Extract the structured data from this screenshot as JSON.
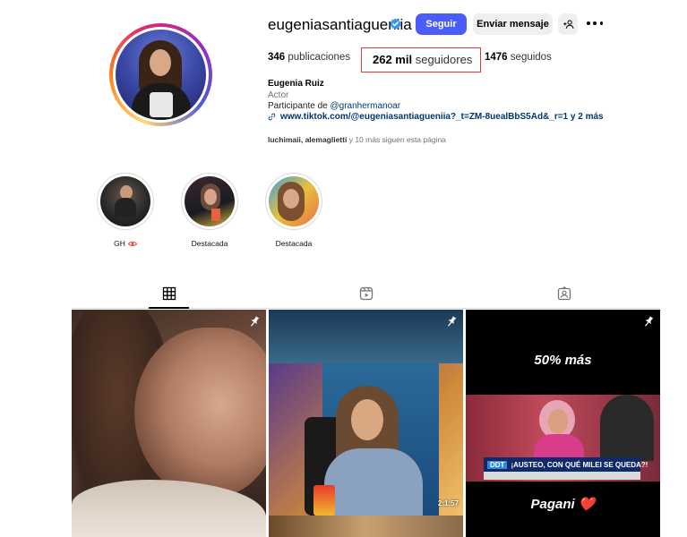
{
  "profile": {
    "username": "eugeniasantiagueniia",
    "follow_label": "Seguir",
    "message_label": "Enviar mensaje",
    "stats": {
      "posts_count": "346",
      "posts_label": "publicaciones",
      "followers_count": "262 mil",
      "followers_label": "seguidores",
      "following_count": "1476",
      "following_label": "seguidos"
    },
    "bio": {
      "name": "Eugenia Ruiz",
      "category": "Actor",
      "line_prefix": "Participante de ",
      "mention": "@granhermanoar",
      "link": "www.tiktok.com/@eugeniasantiagueniia?_t=ZM-8uealBbS5Ad&_r=1 y 2 más"
    },
    "followed_by": {
      "names": "luchimaii, alemaglietti",
      "suffix": " y 10 más siguen esta página"
    }
  },
  "highlights": [
    {
      "label": "GH"
    },
    {
      "label": "Destacada"
    },
    {
      "label": "Destacada"
    }
  ],
  "tabs": [
    {
      "icon": "grid-icon",
      "active": true
    },
    {
      "icon": "reels-icon",
      "active": false
    },
    {
      "icon": "tagged-icon",
      "active": false
    }
  ],
  "posts": [
    {
      "pinned": true
    },
    {
      "pinned": true,
      "duration": "2:1:57"
    },
    {
      "pinned": true,
      "caption_top": "50% más",
      "banner_tag": "DDT",
      "banner_text": "¡AUSTEO, CON QUÉ MILEI SE QUEDA?!",
      "caption_bottom": "Pagani ❤️"
    }
  ],
  "colors": {
    "follow_button": "#4a5df9",
    "verified": "#3897f0",
    "highlight_box": "#d93a3a",
    "link": "#00376b"
  }
}
